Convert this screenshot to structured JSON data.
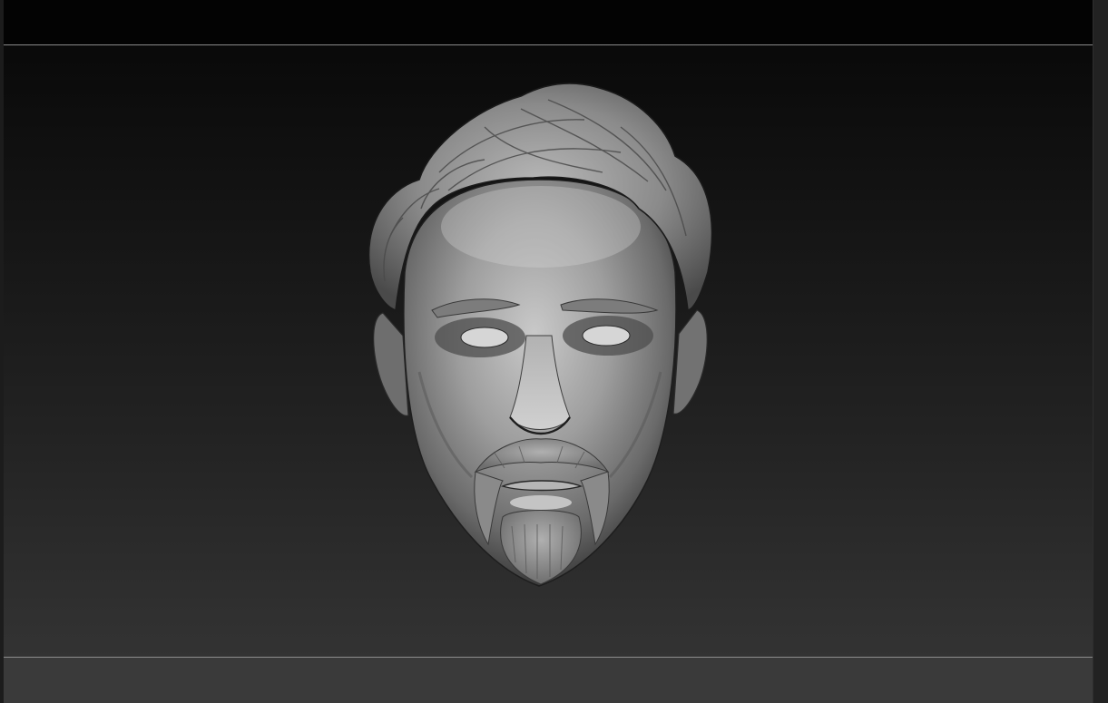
{
  "viewport": {
    "model_name": "sculpted-head",
    "background_colors": {
      "top": "#060606",
      "bottom": "#383838",
      "top_band": "#030303",
      "bottom_band": "#3a3a3a",
      "divider": "#8a8a8a"
    },
    "model_color": "#9a9a9a"
  }
}
